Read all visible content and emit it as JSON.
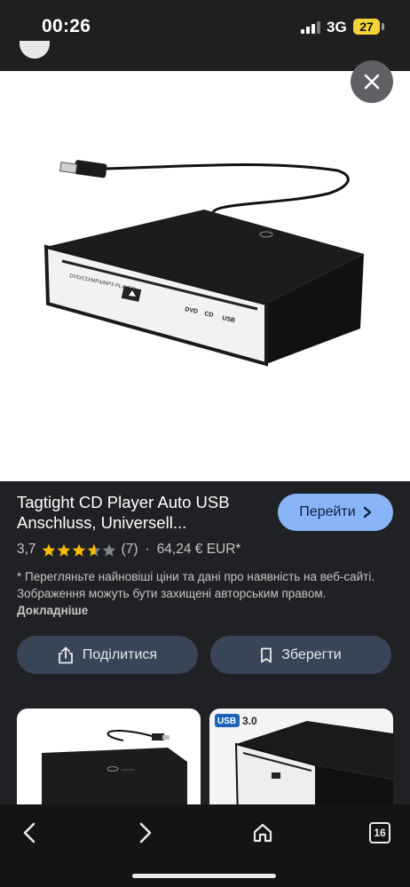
{
  "status_bar": {
    "time": "00:26",
    "network": "3G",
    "battery": "27"
  },
  "product": {
    "title_line1": "Tagtight CD Player Auto USB",
    "title_line2": "Anschluss, Universell...",
    "rating": "3,7",
    "stars_value": 3.7,
    "reviews": "(7)",
    "separator": "·",
    "price": "64,24 € EUR*",
    "disclaimer": "* Перегляньте найновіші ціни та дані про наявність на веб-сайті. Зображення можуть бути захищені авторським правом.",
    "more_link": "Докладніше",
    "visit_label": "Перейти",
    "device_label": "DVD/CD/MP4/MP3 PLAYER"
  },
  "actions": {
    "share_label": "Поділитися",
    "save_label": "Зберегти"
  },
  "related": {
    "card2_badge_usb": "USB",
    "card2_badge_ver": "3.0"
  },
  "bottom_nav": {
    "tabs_count": "16"
  },
  "colors": {
    "accent": "#8ab4f8",
    "star": "#fbbc04",
    "button_bg": "#394457",
    "background": "#202124"
  },
  "icons": {
    "close": "close-icon",
    "share": "share-icon",
    "save": "bookmark-icon",
    "back": "chevron-left-icon",
    "forward": "chevron-right-icon",
    "home": "home-icon",
    "tabs": "tabs-icon"
  }
}
